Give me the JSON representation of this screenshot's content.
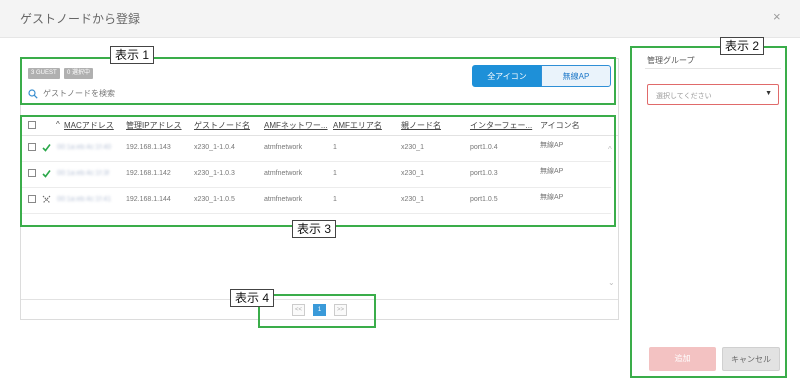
{
  "dialog": {
    "title": "ゲストノードから登録",
    "close_glyph": "×"
  },
  "filters": {
    "guest_badge": "3 GUEST",
    "selected_badge": "0 選択中",
    "search_placeholder": "ゲストノードを検索",
    "view_toggle": {
      "all": "全アイコン",
      "wireless": "無線AP",
      "active": "all"
    }
  },
  "table": {
    "columns": [
      "MACアドレス",
      "管理IPアドレス",
      "ゲストノード名",
      "AMFネットワー...",
      "AMFエリア名",
      "親ノード名",
      "インターフェー...",
      "アイコン名"
    ],
    "sort_glyph": "^",
    "rows": [
      {
        "status": "ok",
        "mac": "00:1a:eb:4c:1f:40",
        "ip": "192.168.1.143",
        "name": "x230_1-1.0.4",
        "network": "atmfnetwork",
        "area": "1",
        "parent": "x230_1",
        "iface": "port1.0.4",
        "icon": "無線AP"
      },
      {
        "status": "ok",
        "mac": "00:1a:eb:4c:1f:3f",
        "ip": "192.168.1.142",
        "name": "x230_1-1.0.3",
        "network": "atmfnetwork",
        "area": "1",
        "parent": "x230_1",
        "iface": "port1.0.3",
        "icon": "無線AP"
      },
      {
        "status": "unknown",
        "mac": "00:1a:eb:4c:1f:41",
        "ip": "192.168.1.144",
        "name": "x230_1-1.0.5",
        "network": "atmfnetwork",
        "area": "1",
        "parent": "x230_1",
        "iface": "port1.0.5",
        "icon": "無線AP"
      }
    ]
  },
  "pagination": {
    "prev": "<<",
    "current": "1",
    "next": ">>"
  },
  "side": {
    "group_label": "管理グループ",
    "select_placeholder": "選択してください",
    "add_label": "追加",
    "cancel_label": "キャンセル"
  },
  "annotations": [
    "表示 1",
    "表示 2",
    "表示 3",
    "表示 4"
  ],
  "colors": {
    "accent": "#1e90d8",
    "callout": "#3aad4a",
    "ok": "#2aa84a",
    "add_disabled": "#f3c2c2",
    "select_border": "#e06a6a"
  }
}
